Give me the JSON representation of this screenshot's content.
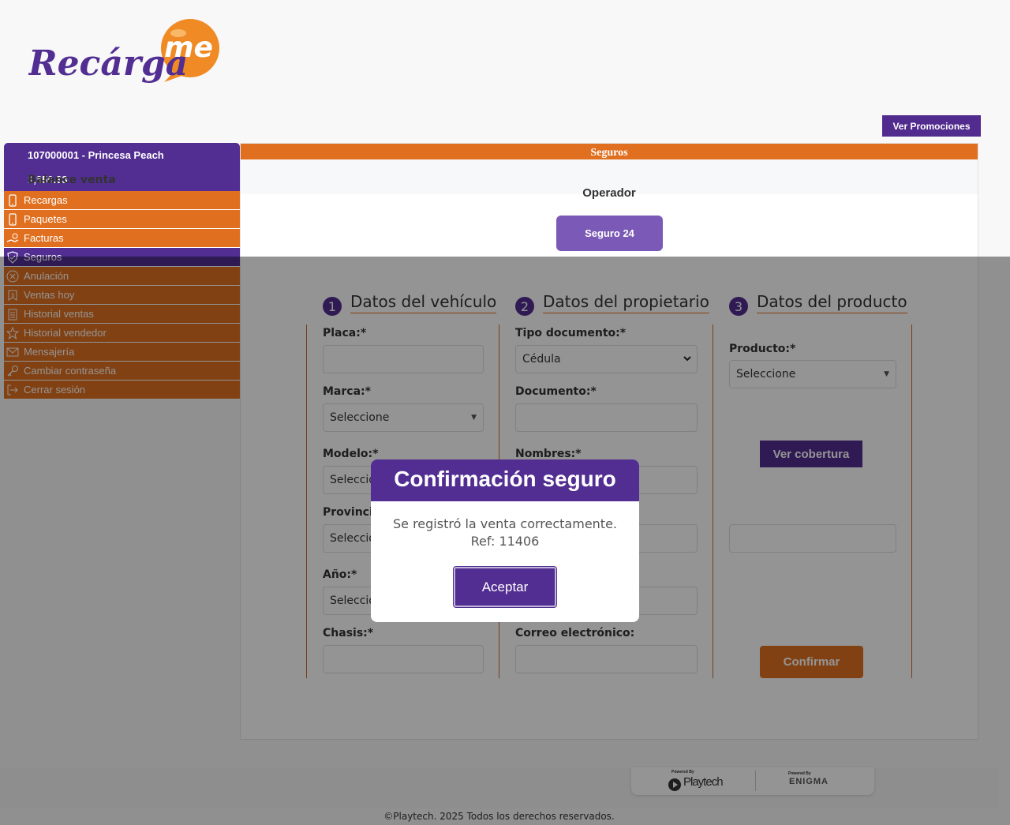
{
  "brand": {
    "logo_text_main": "Recárga",
    "logo_text_bubble": "me"
  },
  "header": {
    "promo_button": "Ver Promociones"
  },
  "account": {
    "id_name": "107000001 - Princesa Peach",
    "balance_label": "Balance venta",
    "balance_value": "1,850.33"
  },
  "menu": [
    {
      "label": "Recargas",
      "icon": "phone-icon"
    },
    {
      "label": "Paquetes",
      "icon": "phone-icon"
    },
    {
      "label": "Facturas",
      "icon": "money-hand-icon"
    },
    {
      "label": "Seguros",
      "icon": "shield-icon"
    },
    {
      "label": "Anulación",
      "icon": "cancel-circle-icon"
    },
    {
      "label": "Ventas hoy",
      "icon": "money-tag-icon"
    },
    {
      "label": "Historial ventas",
      "icon": "clipboard-icon"
    },
    {
      "label": "Historial vendedor",
      "icon": "star-icon"
    },
    {
      "label": "Mensajería",
      "icon": "envelope-icon"
    },
    {
      "label": "Cambiar contraseña",
      "icon": "key-icon"
    },
    {
      "label": "Cerrar sesión",
      "icon": "logout-icon"
    }
  ],
  "main": {
    "title": "Seguros",
    "operator_label": "Operador",
    "operator_button": "Seguro 24",
    "steps": [
      {
        "num": "1",
        "title": "Datos del vehículo"
      },
      {
        "num": "2",
        "title": "Datos del propietario"
      },
      {
        "num": "3",
        "title": "Datos del producto"
      }
    ],
    "vehicle": {
      "placa_label": "Placa:*",
      "placa_value": "",
      "marca_label": "Marca:*",
      "marca_value": "Seleccione",
      "modelo_label": "Modelo:*",
      "modelo_value": "Seleccione",
      "provincia_label": "Provincia:*",
      "provincia_value": "Seleccione",
      "anio_label": "Año:*",
      "anio_value": "Seleccione",
      "chasis_label": "Chasis:*",
      "chasis_value": ""
    },
    "owner": {
      "tipo_label": "Tipo documento:*",
      "tipo_value": "Cédula",
      "documento_label": "Documento:*",
      "documento_value": "",
      "nombres_label": "Nombres:*",
      "nombres_value": "",
      "apellidos_value": "",
      "telefono_value": "",
      "correo_label": "Correo electrónico:",
      "correo_value": ""
    },
    "product": {
      "producto_label": "Producto:*",
      "producto_value": "Seleccione",
      "cobertura_button": "Ver cobertura",
      "monto_value": "",
      "confirm_button": "Confirmar"
    }
  },
  "footer": {
    "powered_by_1": "Powered By",
    "brand_1": "Playtech",
    "powered_by_2": "Powered By",
    "brand_2": "ENIGMA",
    "copyright": "©Playtech. 2025 Todos los derechos reservados."
  },
  "modal": {
    "title": "Confirmación seguro",
    "message": "Se registró la venta correctamente.",
    "reference": "Ref: 11406",
    "accept_button": "Aceptar"
  },
  "colors": {
    "purple": "#522e92",
    "orange": "#e07020",
    "light_purple": "#7b59b6"
  }
}
